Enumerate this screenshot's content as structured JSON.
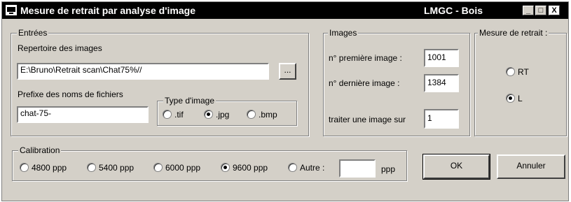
{
  "window": {
    "title": "Mesure de retrait par analyse d'image",
    "right_title": "LMGC - Bois",
    "minimize_glyph": "_",
    "maximize_glyph": "□",
    "close_glyph": "X"
  },
  "entrees": {
    "legend": "Entrées",
    "repertoire_label": "Repertoire des images",
    "repertoire_value": "E:\\Bruno\\Retrait scan\\Chat75%//",
    "browse_label": "...",
    "prefixe_label": "Prefixe des noms de fichiers",
    "prefixe_value": "chat-75-",
    "type_legend": "Type d'image",
    "types": [
      {
        "label": ".tif",
        "selected": false
      },
      {
        "label": ".jpg",
        "selected": true
      },
      {
        "label": ".bmp",
        "selected": false
      }
    ]
  },
  "images": {
    "legend": "Images",
    "premiere_label": "n° première image :",
    "premiere_value": "1001",
    "derniere_label": "n° dernière image :",
    "derniere_value": "1384",
    "traiter_label": "traiter une image sur",
    "traiter_value": "1"
  },
  "mesure": {
    "legend": "Mesure de retrait :",
    "options": [
      {
        "label": "RT",
        "selected": false
      },
      {
        "label": "L",
        "selected": true
      }
    ]
  },
  "calibration": {
    "legend": "Calibration",
    "options": [
      {
        "label": "4800 ppp",
        "selected": false
      },
      {
        "label": "5400 ppp",
        "selected": false
      },
      {
        "label": "6000 ppp",
        "selected": false
      },
      {
        "label": "9600 ppp",
        "selected": true
      },
      {
        "label": "Autre :",
        "selected": false
      }
    ],
    "autre_value": "",
    "unit": "ppp"
  },
  "buttons": {
    "ok": "OK",
    "cancel": "Annuler"
  }
}
